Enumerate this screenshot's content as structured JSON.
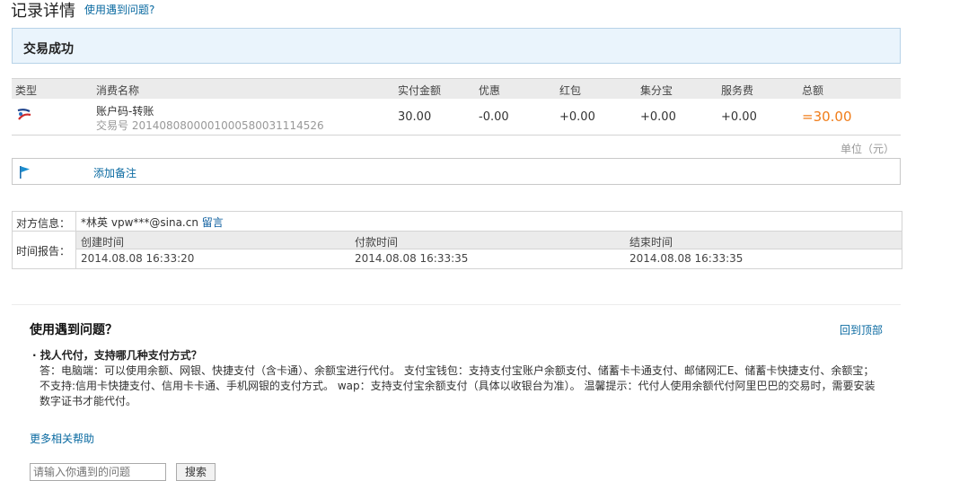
{
  "header": {
    "title": "记录详情",
    "help_link": "使用遇到问题?"
  },
  "status": {
    "text": "交易成功"
  },
  "table": {
    "columns": [
      "类型",
      "消费名称",
      "实付金额",
      "优惠",
      "红包",
      "集分宝",
      "服务费",
      "总额"
    ],
    "row": {
      "type_icon": "transfer-icon",
      "name": "账户码-转账",
      "tx_label": "交易号",
      "tx_no": "2014080800001000580031114526",
      "paid": "30.00",
      "discount": "-0.00",
      "red_packet": "+0.00",
      "points": "+0.00",
      "service_fee": "+0.00",
      "total": "=30.00"
    },
    "unit": "单位（元）"
  },
  "remark": {
    "icon": "flag-icon",
    "label": "添加备注"
  },
  "counterparty": {
    "label": "对方信息：",
    "name": "*林英",
    "account": "vpw***@sina.cn",
    "message_link": "留言"
  },
  "time_report": {
    "label": "时间报告：",
    "headers": [
      "创建时间",
      "付款时间",
      "结束时间"
    ],
    "values": [
      "2014.08.08 16:33:20",
      "2014.08.08 16:33:35",
      "2014.08.08 16:33:35"
    ]
  },
  "faq": {
    "title": "使用遇到问题？",
    "back_to_top": "回到顶部",
    "question": "找人代付，支持哪几种支付方式？",
    "answer_line1": "答：电脑端：可以使用余额、网银、快捷支付（含卡通）、余额宝进行代付。 支付宝钱包：支持支付宝账户余额支付、储蓄卡卡通支付、邮储网汇E、储蓄卡快捷支付、余额宝；",
    "answer_line2": "不支持:信用卡快捷支付、信用卡卡通、手机网银的支付方式。 wap：支持支付宝余额支付（具体以收银台为准）。 温馨提示：代付人使用余额代付阿里巴巴的交易时，需要安装",
    "answer_line3": "数字证书才能代付。",
    "more_help": "更多相关帮助",
    "search_placeholder": "请输入你遇到的问题",
    "search_button": "搜索"
  }
}
